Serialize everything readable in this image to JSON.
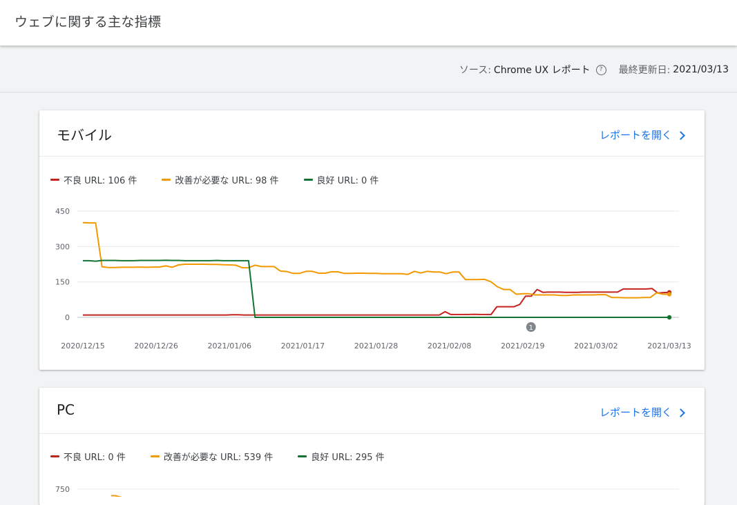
{
  "header": {
    "title": "ウェブに関する主な指標"
  },
  "source_bar": {
    "source_prefix": "ソース: ",
    "source_name": "Chrome UX レポート",
    "help_icon": "help-icon",
    "updated_prefix": "最終更新日: ",
    "updated_date": "2021/03/13"
  },
  "colors": {
    "poor": "#c5221f",
    "needs_improvement": "#f29900",
    "good": "#137333",
    "link": "#1a73e8"
  },
  "mobile": {
    "title": "モバイル",
    "open_report": "レポートを開く",
    "legend": [
      {
        "label": "不良 URL: 106 件"
      },
      {
        "label": "改善が必要な URL: 98 件"
      },
      {
        "label": "良好 URL: 0 件"
      }
    ],
    "annotation": "1",
    "chart_data": {
      "type": "line",
      "ylim": [
        0,
        450
      ],
      "yticks": [
        "0",
        "150",
        "300",
        "450"
      ],
      "xticks": [
        "2020/12/15",
        "2020/12/26",
        "2021/01/06",
        "2021/01/17",
        "2021/01/28",
        "2021/02/08",
        "2021/02/19",
        "2021/03/02",
        "2021/03/13"
      ],
      "series": [
        {
          "name": "不良 URL",
          "values": [
            10,
            10,
            10,
            10,
            10,
            10,
            10,
            10,
            10,
            10,
            10,
            10,
            10,
            10,
            10,
            10,
            10,
            10,
            10,
            10,
            10,
            10,
            10,
            10,
            10,
            10,
            11,
            11,
            10,
            10,
            10,
            10,
            10,
            10,
            10,
            10,
            10,
            10,
            10,
            10,
            10,
            10,
            10,
            10,
            10,
            10,
            10,
            10,
            10,
            10,
            10,
            10,
            10,
            10,
            10,
            10,
            10,
            10,
            10,
            10,
            10,
            10,
            10,
            24,
            12,
            12,
            12,
            12,
            13,
            12,
            12,
            12,
            45,
            45,
            45,
            45,
            55,
            90,
            90,
            118,
            106,
            107,
            107,
            107,
            106,
            106,
            106,
            107,
            107,
            107,
            107,
            107,
            107,
            107,
            120,
            120,
            120,
            120,
            120,
            122,
            103,
            105,
            106
          ]
        },
        {
          "name": "改善が必要な URL",
          "values": [
            401,
            400,
            400,
            214,
            211,
            211,
            212,
            212,
            212,
            213,
            212,
            213,
            213,
            218,
            212,
            222,
            225,
            225,
            225,
            225,
            224,
            224,
            223,
            222,
            221,
            210,
            210,
            221,
            215,
            215,
            215,
            196,
            194,
            186,
            186,
            195,
            195,
            187,
            187,
            193,
            193,
            186,
            186,
            187,
            187,
            186,
            186,
            185,
            185,
            185,
            185,
            182,
            195,
            188,
            195,
            192,
            192,
            185,
            192,
            192,
            160,
            160,
            160,
            161,
            151,
            130,
            118,
            118,
            98,
            100,
            100,
            95,
            95,
            95,
            95,
            93,
            93,
            95,
            95,
            95,
            95,
            96,
            96,
            84,
            84,
            83,
            83,
            83,
            84,
            84,
            104,
            98,
            98
          ]
        },
        {
          "name": "良好 URL",
          "values": [
            240,
            240,
            238,
            241,
            241,
            241,
            240,
            240,
            240,
            241,
            241,
            241,
            241,
            242,
            241,
            241,
            240,
            240,
            240,
            240,
            240,
            241,
            240,
            240,
            240,
            240,
            240,
            0,
            0,
            0,
            0,
            0,
            0,
            0,
            0,
            0,
            0,
            0,
            0,
            0,
            0,
            0,
            0,
            0,
            0,
            0,
            0,
            0,
            0,
            0,
            0,
            0,
            0,
            0,
            0,
            0,
            0,
            0,
            0,
            0,
            0,
            0,
            0,
            0,
            0,
            0,
            0,
            0,
            0,
            0,
            0,
            0,
            0,
            0,
            0,
            0,
            0,
            0,
            0,
            0,
            0,
            0,
            0,
            0,
            0,
            0,
            0,
            0,
            0,
            0,
            0,
            0,
            0
          ]
        }
      ]
    }
  },
  "pc": {
    "title": "PC",
    "open_report": "レポートを開く",
    "legend": [
      {
        "label": "不良 URL: 0 件"
      },
      {
        "label": "改善が必要な URL: 539 件"
      },
      {
        "label": "良好 URL: 295 件"
      }
    ],
    "chart_data": {
      "type": "line",
      "yticks": [
        "750"
      ],
      "series": [
        {
          "name": "改善が必要な URL",
          "values": [
            720,
            720,
            710,
            650
          ]
        }
      ]
    }
  }
}
